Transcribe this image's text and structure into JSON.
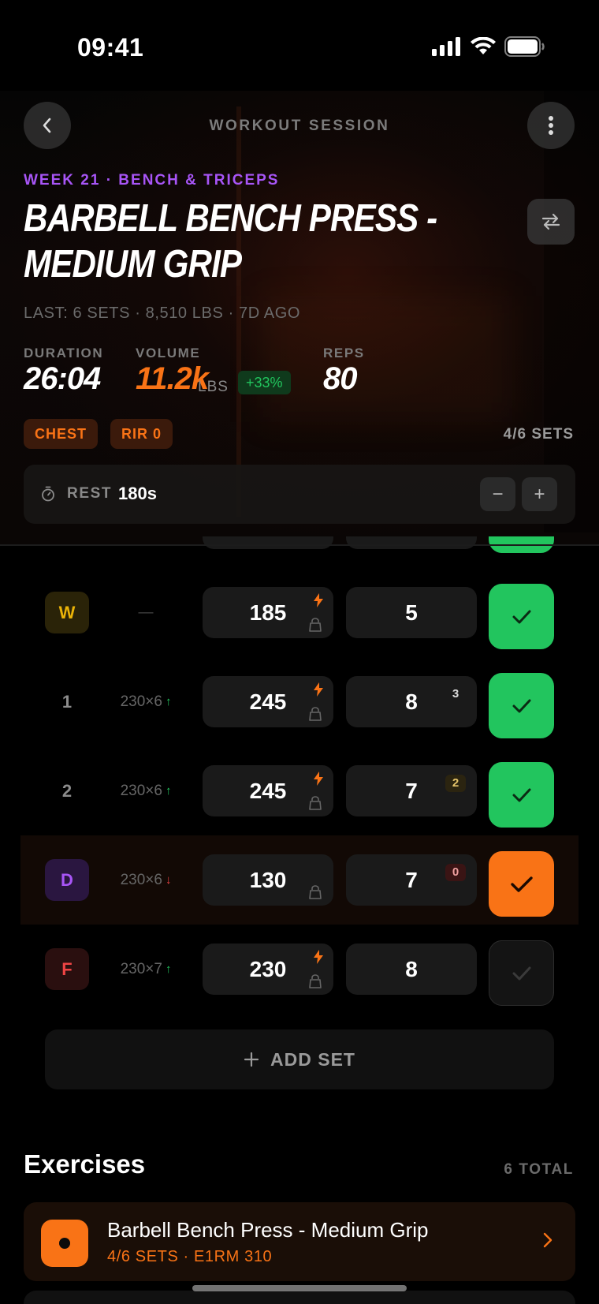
{
  "status_bar": {
    "time": "09:41"
  },
  "header": {
    "title": "WORKOUT SESSION"
  },
  "exercise": {
    "eyebrow": "WEEK 21 · BENCH & TRICEPS",
    "title": "BARBELL BENCH PRESS - MEDIUM GRIP",
    "last": "LAST: 6 SETS · 8,510 LBS · 7D AGO"
  },
  "stats": {
    "duration_label": "DURATION",
    "duration_value": "26:04",
    "volume_label": "VOLUME",
    "volume_value": "11.2k",
    "volume_unit": "LBS",
    "volume_delta": "+33%",
    "reps_label": "REPS",
    "reps_value": "80"
  },
  "tags": [
    "CHEST",
    "RIR 0"
  ],
  "sets_progress": "4/6 SETS",
  "rest": {
    "label": "REST",
    "value": "180s",
    "minus": "−",
    "plus": "+"
  },
  "sets": [
    {
      "type": "W",
      "previous": "—",
      "trend": "",
      "weight": "185",
      "boost": true,
      "reps": "5",
      "rir": "",
      "status": "done"
    },
    {
      "type": "1",
      "previous": "230×6",
      "trend": "↑",
      "weight": "245",
      "boost": true,
      "reps": "8",
      "rir": "3",
      "status": "done"
    },
    {
      "type": "2",
      "previous": "230×6",
      "trend": "↑",
      "weight": "245",
      "boost": true,
      "reps": "7",
      "rir": "2",
      "status": "done"
    },
    {
      "type": "D",
      "previous": "230×6",
      "trend": "↓",
      "weight": "130",
      "boost": false,
      "reps": "7",
      "rir": "0",
      "status": "current"
    },
    {
      "type": "F",
      "previous": "230×7",
      "trend": "↑",
      "weight": "230",
      "boost": true,
      "reps": "8",
      "rir": "",
      "status": "pending"
    }
  ],
  "add_set": {
    "label": "ADD SET"
  },
  "exercises_section": {
    "title": "Exercises",
    "total": "6 TOTAL",
    "items": [
      {
        "name": "Barbell Bench Press - Medium Grip",
        "sub": "4/6 SETS · E1RM 310"
      }
    ]
  },
  "colors": {
    "accent": "#f97316",
    "purple": "#a855f7",
    "green": "#22c55e",
    "warmup": "#eab308",
    "dropset": "#a855f7",
    "failure": "#ef4444"
  }
}
